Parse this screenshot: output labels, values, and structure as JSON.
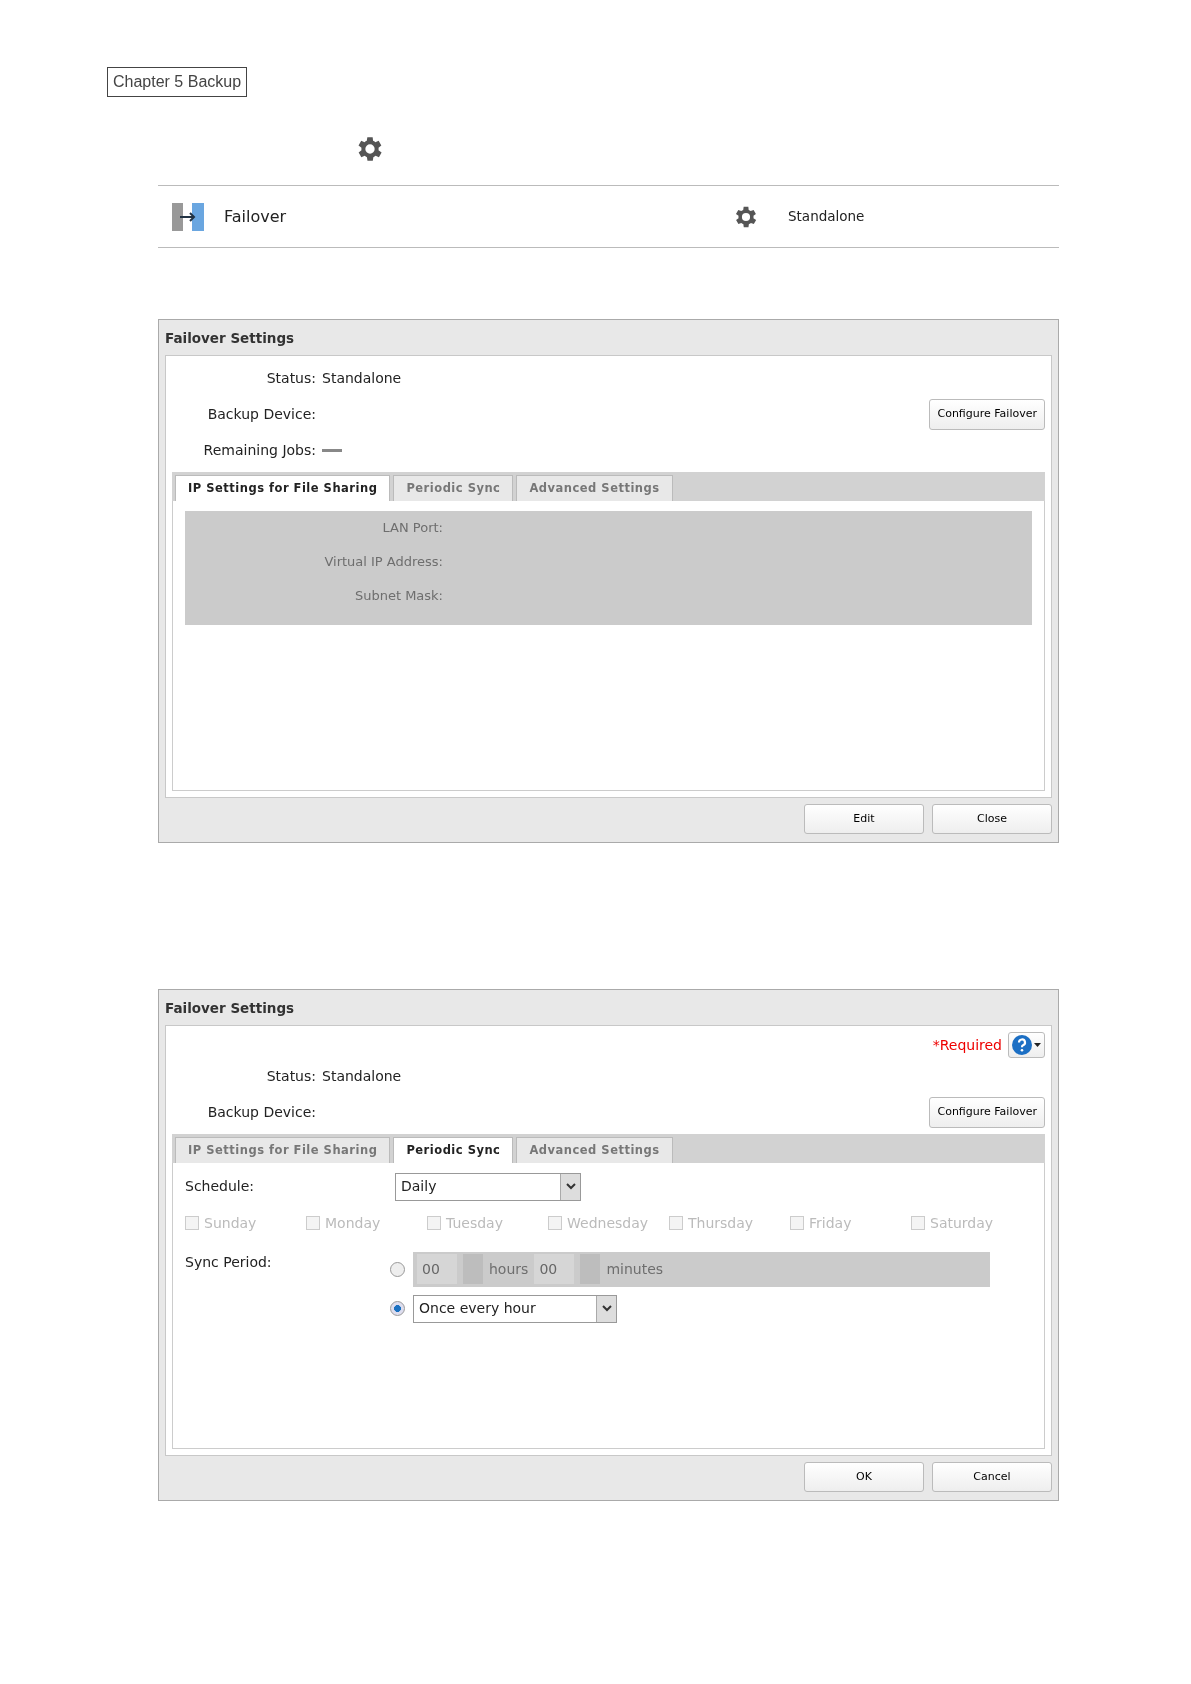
{
  "chapter_label": "Chapter 5 Backup",
  "service_row": {
    "name": "Failover",
    "status": "Standalone"
  },
  "dialogs": [
    {
      "title": "Failover Settings",
      "fields": [
        {
          "kind": "text",
          "label": "Status:",
          "value": "Standalone"
        },
        {
          "kind": "text",
          "label": "Backup Device:"
        },
        {
          "kind": "dash",
          "label": "Remaining Jobs:"
        }
      ],
      "configure_button": "Configure Failover",
      "tabs": [
        {
          "label": "IP Settings for File Sharing",
          "selected": true
        },
        {
          "label": "Periodic Sync",
          "selected": false
        },
        {
          "label": "Advanced Settings",
          "selected": false
        }
      ],
      "content": {
        "kind": "ip",
        "disabled": true,
        "labels": [
          "LAN Port:",
          "Virtual IP Address:",
          "Subnet Mask:"
        ]
      },
      "buttons": [
        "Edit",
        "Close"
      ]
    },
    {
      "title": "Failover Settings",
      "required": "*Required",
      "fields": [
        {
          "kind": "text",
          "label": "Status:",
          "value": "Standalone"
        },
        {
          "kind": "text",
          "label": "Backup Device:"
        }
      ],
      "configure_button": "Configure Failover",
      "tabs": [
        {
          "label": "IP Settings for File Sharing",
          "selected": false
        },
        {
          "label": "Periodic Sync",
          "selected": true
        },
        {
          "label": "Advanced Settings",
          "selected": false
        }
      ],
      "content": {
        "kind": "sync",
        "schedule_label": "Schedule:",
        "schedule_value": "Daily",
        "days": [
          {
            "label": "Sunday",
            "checked": false,
            "disabled": true
          },
          {
            "label": "Monday",
            "checked": false,
            "disabled": true
          },
          {
            "label": "Tuesday",
            "checked": false,
            "disabled": true
          },
          {
            "label": "Wednesday",
            "checked": false,
            "disabled": true
          },
          {
            "label": "Thursday",
            "checked": false,
            "disabled": true
          },
          {
            "label": "Friday",
            "checked": false,
            "disabled": true
          },
          {
            "label": "Saturday",
            "checked": false,
            "disabled": true
          }
        ],
        "sync_label": "Sync Period:",
        "options": [
          {
            "kind": "custom",
            "selected": false,
            "disabled": true,
            "hours": "00",
            "hours_unit": "hours",
            "minutes": "00",
            "minutes_unit": "minutes"
          },
          {
            "kind": "preset",
            "selected": true,
            "value": "Once every hour"
          }
        ]
      },
      "buttons": [
        "OK",
        "Cancel"
      ]
    }
  ]
}
